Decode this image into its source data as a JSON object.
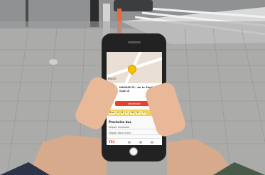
{
  "screen": {
    "map_label": "Route",
    "stop_name": "NAMUR PL. de la Station - Quai A",
    "departure_button": "Itinéraire",
    "line_label": "Bus",
    "line_codes": [
      "4",
      "8",
      "9",
      "16",
      "51",
      "27"
    ],
    "section_title": "Prochains bus",
    "rows": [
      "Départ immédiat",
      "Départ dans 4 min"
    ],
    "brand": "TEC"
  },
  "colors": {
    "accent": "#e6412b",
    "highlight": "#f4c200"
  }
}
